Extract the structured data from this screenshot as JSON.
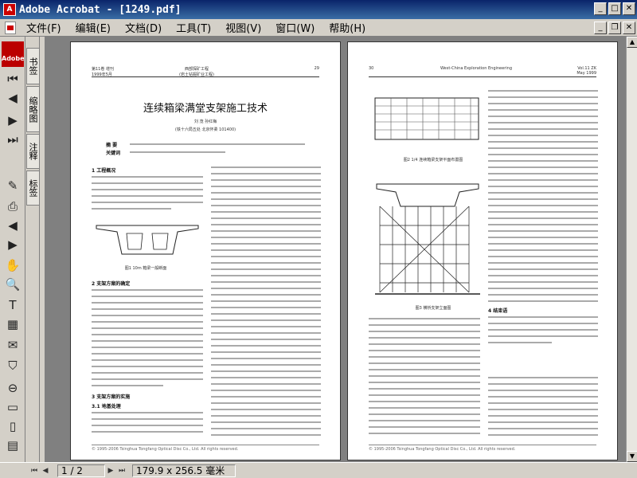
{
  "window": {
    "title": "Adobe Acrobat - [1249.pdf]"
  },
  "menu": [
    "文件(F)",
    "编辑(E)",
    "文档(D)",
    "工具(T)",
    "视图(V)",
    "窗口(W)",
    "帮助(H)"
  ],
  "tabs": [
    "书签",
    "缩略图",
    "注释",
    "标签"
  ],
  "toolbar_logo": "Adobe",
  "left_page": {
    "header_left": "第11卷 增刊\n1999年5月",
    "header_center": "西部探矿工程\n(岩土钻掘矿业工程)",
    "header_right": "29",
    "title": "连续箱梁满堂支架施工技术",
    "author": "刘 茂  孙红梅",
    "affiliation": "(铁十六局五处  北京怀柔  101400)",
    "abstract_label": "摘  要",
    "keywords_label": "关键词",
    "fig_caption": "图1  10m 箱梁一般断面",
    "heading1": "1  工程概况",
    "heading2": "2  支架方案的确定",
    "heading3": "3  支架方案的实施",
    "heading3_1": "3.1  地基处理",
    "footer": "© 1995-2006 Tsinghua Tongfang Optical Disc Co., Ltd.  All rights reserved."
  },
  "right_page": {
    "header_left": "30",
    "header_center": "West-China Exploration Engineering",
    "header_right": "Vol.11 ZK\nMay 1999",
    "fig2_caption": "图2  1/4 连续箱梁支架平面布置图",
    "fig3_caption": "图3  横桥支架立面图",
    "heading4": "4  结束语",
    "footer": "© 1995-2006 Tsinghua Tongfang Optical Disc Co., Ltd.  All rights reserved."
  },
  "status": {
    "page": "1 / 2",
    "size": "179.9 x 256.5 毫米"
  }
}
